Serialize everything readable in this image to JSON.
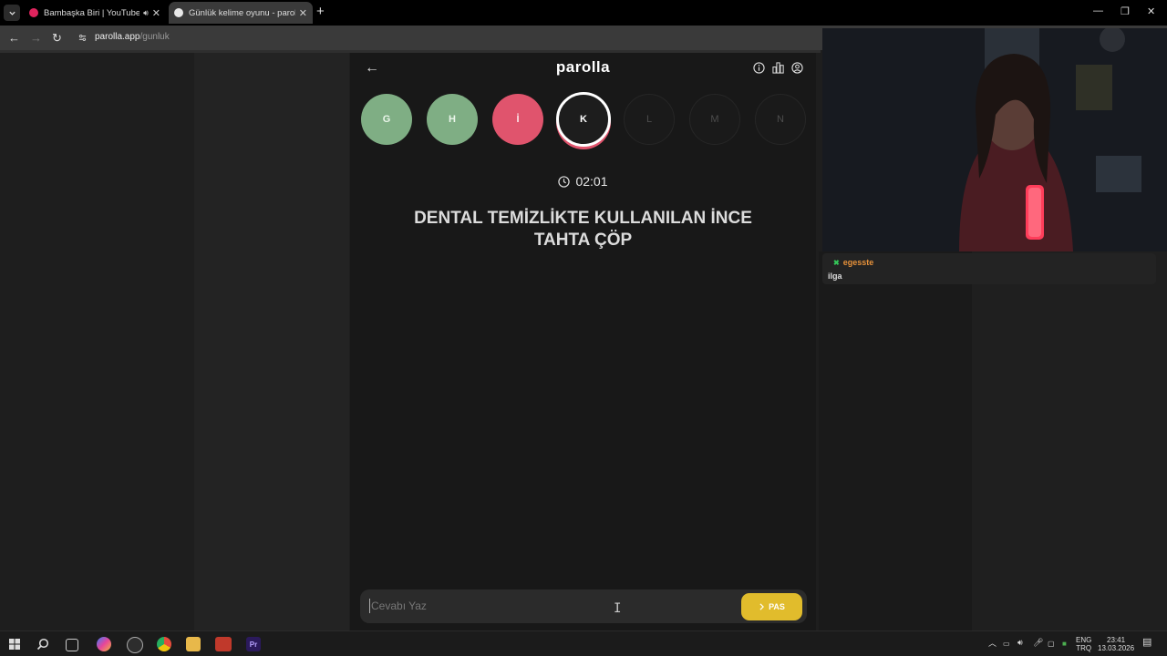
{
  "browser": {
    "tabs": [
      {
        "title": "Bambaşka Biri | YouTube Mu",
        "favicon_color": "#e0245e",
        "audio": true
      },
      {
        "title": "Günlük kelime oyunu - parolla",
        "favicon_color": "#e8e8e8",
        "active": true
      }
    ],
    "url": {
      "host": "parolla.app",
      "path": "/gunluk"
    }
  },
  "game": {
    "brand": "parolla",
    "letters": [
      {
        "letter": "G",
        "state": "correct"
      },
      {
        "letter": "H",
        "state": "correct"
      },
      {
        "letter": "İ",
        "state": "wrong"
      },
      {
        "letter": "K",
        "state": "active"
      },
      {
        "letter": "L",
        "state": "future"
      },
      {
        "letter": "M",
        "state": "future"
      },
      {
        "letter": "N",
        "state": "future"
      }
    ],
    "timer": "02:01",
    "question_line1": "DENTAL TEMİZLİKTE KULLANILAN İNCE",
    "question_line2": "TAHTA ÇÖP",
    "answer_placeholder": "Cevabı Yaz",
    "pass_label": "PAS",
    "colors": {
      "correct": "#7fae84",
      "wrong": "#e0546d",
      "accent": "#e1bc2c"
    }
  },
  "chat": {
    "username": "egesste",
    "message": "ilga"
  },
  "taskbar": {
    "lang1": "ENG",
    "lang2": "TRQ",
    "time": "23:41",
    "date": "13.03.2026"
  }
}
